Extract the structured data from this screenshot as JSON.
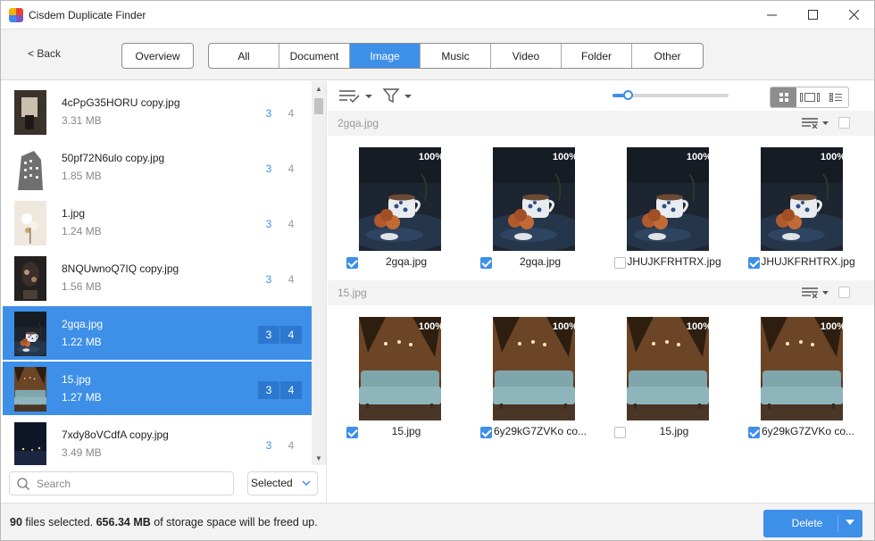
{
  "app": {
    "title": "Cisdem Duplicate Finder",
    "icon": "app-logo-icon",
    "window_controls": [
      "minimize-icon",
      "maximize-icon",
      "close-icon"
    ]
  },
  "toolbar": {
    "back_label": "< Back",
    "overview_label": "Overview",
    "tabs": [
      {
        "label": "All",
        "active": false
      },
      {
        "label": "Document",
        "active": false
      },
      {
        "label": "Image",
        "active": true
      },
      {
        "label": "Music",
        "active": false
      },
      {
        "label": "Video",
        "active": false
      },
      {
        "label": "Folder",
        "active": false
      },
      {
        "label": "Other",
        "active": false
      }
    ]
  },
  "file_list": [
    {
      "name": "4cPpG35HORU copy.jpg",
      "size": "3.31 MB",
      "count_a": "3",
      "count_b": "4",
      "selected": false,
      "thumb": "dark-room"
    },
    {
      "name": "50pf72N6ulo copy.jpg",
      "size": "1.85 MB",
      "count_a": "3",
      "count_b": "4",
      "selected": false,
      "thumb": "building"
    },
    {
      "name": "1.jpg",
      "size": "1.24 MB",
      "count_a": "3",
      "count_b": "4",
      "selected": false,
      "thumb": "flowers"
    },
    {
      "name": "8NQUwnoQ7IQ copy.jpg",
      "size": "1.56 MB",
      "count_a": "3",
      "count_b": "4",
      "selected": false,
      "thumb": "dark-plant"
    },
    {
      "name": "2gqa.jpg",
      "size": "1.22 MB",
      "count_a": "3",
      "count_b": "4",
      "selected": true,
      "thumb": "coffee"
    },
    {
      "name": "15.jpg",
      "size": "1.27 MB",
      "count_a": "3",
      "count_b": "4",
      "selected": true,
      "thumb": "sofa"
    },
    {
      "name": "7xdy8oVCdfA copy.jpg",
      "size": "3.49 MB",
      "count_a": "3",
      "count_b": "4",
      "selected": false,
      "thumb": "night"
    }
  ],
  "search": {
    "placeholder": "Search",
    "value": ""
  },
  "filter_select": {
    "value": "Selected"
  },
  "view": {
    "zoom_level": 0.13,
    "modes": [
      {
        "icon": "grid-view-icon",
        "active": true
      },
      {
        "icon": "carousel-view-icon",
        "active": false
      },
      {
        "icon": "list-view-icon",
        "active": false
      }
    ]
  },
  "groups": [
    {
      "name": "2gqa.jpg",
      "items": [
        {
          "name": "2gqa.jpg",
          "similarity": "100%",
          "checked": true,
          "image": "coffee"
        },
        {
          "name": "2gqa.jpg",
          "similarity": "100%",
          "checked": true,
          "image": "coffee"
        },
        {
          "name": "JHUJKFRHTRX.jpg",
          "similarity": "100%",
          "checked": false,
          "image": "coffee"
        },
        {
          "name": "JHUJKFRHTRX.jpg",
          "similarity": "100%",
          "checked": true,
          "image": "coffee"
        }
      ]
    },
    {
      "name": "15.jpg",
      "items": [
        {
          "name": "15.jpg",
          "similarity": "100%",
          "checked": true,
          "image": "sofa"
        },
        {
          "name": "6y29kG7ZVKo co...",
          "similarity": "100%",
          "checked": true,
          "image": "sofa"
        },
        {
          "name": "15.jpg",
          "similarity": "100%",
          "checked": false,
          "image": "sofa"
        },
        {
          "name": "6y29kG7ZVKo co...",
          "similarity": "100%",
          "checked": true,
          "image": "sofa"
        }
      ]
    }
  ],
  "status": {
    "files_count": "90",
    "files_text": "files selected.",
    "size": "656.34 MB",
    "size_text": "of storage space will be freed up."
  },
  "delete_label": "Delete",
  "colors": {
    "accent": "#3d8fe8",
    "accent_dark": "#2c78d0",
    "toolbar_bg": "#f3f3f3"
  }
}
